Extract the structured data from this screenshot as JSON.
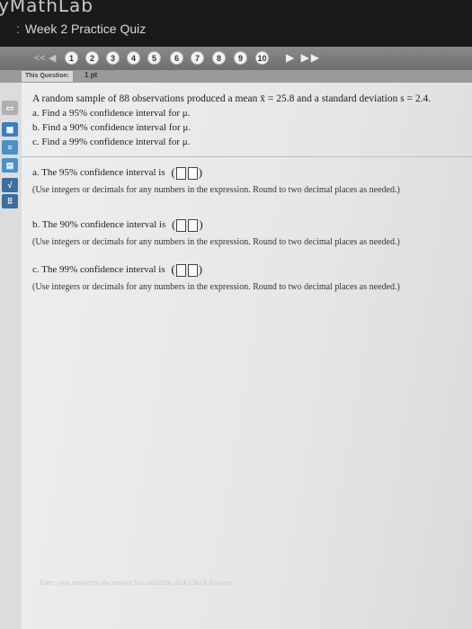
{
  "app": {
    "brand": "yMathLab",
    "quiz_title": "Week 2 Practice Quiz"
  },
  "nav": {
    "prev": "<<  ◀",
    "questions": [
      "1",
      "2",
      "3",
      "4",
      "5",
      "6",
      "7",
      "8",
      "9",
      "10"
    ],
    "next": "▶  ▶▶"
  },
  "question_bar": {
    "tag": "This Question:",
    "points": "1 pt"
  },
  "question": {
    "stem": "A random sample of 88 observations produced a mean x̄ = 25.8 and a standard deviation s = 2.4.",
    "a": "a. Find a 95% confidence interval for μ.",
    "b": "b. Find a 90% confidence interval for μ.",
    "c": "c. Find a 99% confidence interval for μ."
  },
  "answers": {
    "a_label": "a. The 95% confidence interval is",
    "b_label": "b. The 90% confidence interval is",
    "c_label": "c. The 99% confidence interval is",
    "note": "(Use integers or decimals for any numbers in the expression. Round to two decimal places as needed.)"
  },
  "footer": "Enter your answer in the answer box and then click Check Answer."
}
